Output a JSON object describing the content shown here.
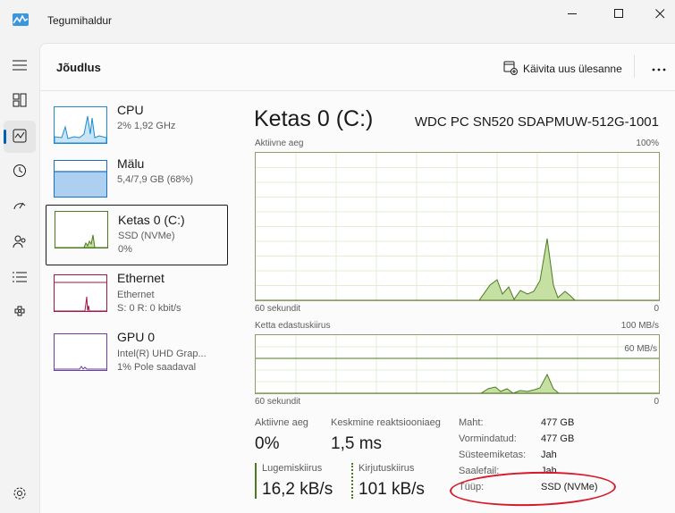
{
  "window": {
    "title": "Tegumihaldur",
    "app_icon": "task-manager-icon",
    "controls": [
      "minimize-icon",
      "maximize-icon",
      "close-icon"
    ]
  },
  "rail": {
    "items": [
      {
        "icon": "hamburger-menu-icon"
      },
      {
        "icon": "processes-icon"
      },
      {
        "icon": "performance-icon",
        "active": true
      },
      {
        "icon": "app-history-icon"
      },
      {
        "icon": "startup-apps-icon"
      },
      {
        "icon": "users-icon"
      },
      {
        "icon": "details-icon"
      },
      {
        "icon": "services-icon"
      },
      {
        "icon": "settings-icon"
      }
    ]
  },
  "header": {
    "page_title": "Jõudlus",
    "run_task_label": "Käivita uus ülesanne",
    "run_task_icon": "new-task-icon",
    "more_icon": "more-options-icon"
  },
  "devices": [
    {
      "name": "CPU",
      "sub1": "2% 1,92 GHz",
      "sub2": ""
    },
    {
      "name": "Mälu",
      "sub1": "5,4/7,9 GB (68%)",
      "sub2": ""
    },
    {
      "name": "Ketas 0 (C:)",
      "sub1": "SSD (NVMe)",
      "sub2": "0%"
    },
    {
      "name": "Ethernet",
      "sub1": "Ethernet",
      "sub2": "S: 0 R: 0 kbit/s"
    },
    {
      "name": "GPU 0",
      "sub1": "Intel(R) UHD Grap...",
      "sub2": "1% Pole saadaval"
    }
  ],
  "detail": {
    "title": "Ketas 0 (C:)",
    "model": "WDC PC SN520 SDAPMUW-512G-1001",
    "graph1": {
      "label": "Aktiivne aeg",
      "max": "100%",
      "time": "60 sekundit",
      "min": "0"
    },
    "graph2": {
      "label": "Ketta edastuskiirus",
      "max": "100 MB/s",
      "line_label": "60 MB/s",
      "time": "60 sekundit",
      "min": "0"
    },
    "stats": {
      "active_label": "Aktiivne aeg",
      "active_value": "0%",
      "response_label": "Keskmine reaktsiooniaeg",
      "response_value": "1,5 ms",
      "read_label": "Lugemiskiirus",
      "read_value": "16,2 kB/s",
      "write_label": "Kirjutuskiirus",
      "write_value": "101 kB/s"
    },
    "info": [
      {
        "label": "Maht:",
        "value": "477 GB"
      },
      {
        "label": "Vormindatud:",
        "value": "477 GB"
      },
      {
        "label": "Süsteemiketas:",
        "value": "Jah"
      },
      {
        "label": "Saalefail:",
        "value": "Jah"
      },
      {
        "label": "Tüüp:",
        "value": "SSD (NVMe)"
      }
    ]
  },
  "colors": {
    "accent": "#005fb8",
    "disk_green": "#4c7a1e",
    "disk_fill": "#c6e0a4",
    "cpu_blue": "#1a8ccf",
    "memory_blue": "#1a6fc4",
    "ethernet_red": "#a1154a",
    "gpu_purple": "#6b3fa0",
    "annotation_red": "#d7192a"
  }
}
